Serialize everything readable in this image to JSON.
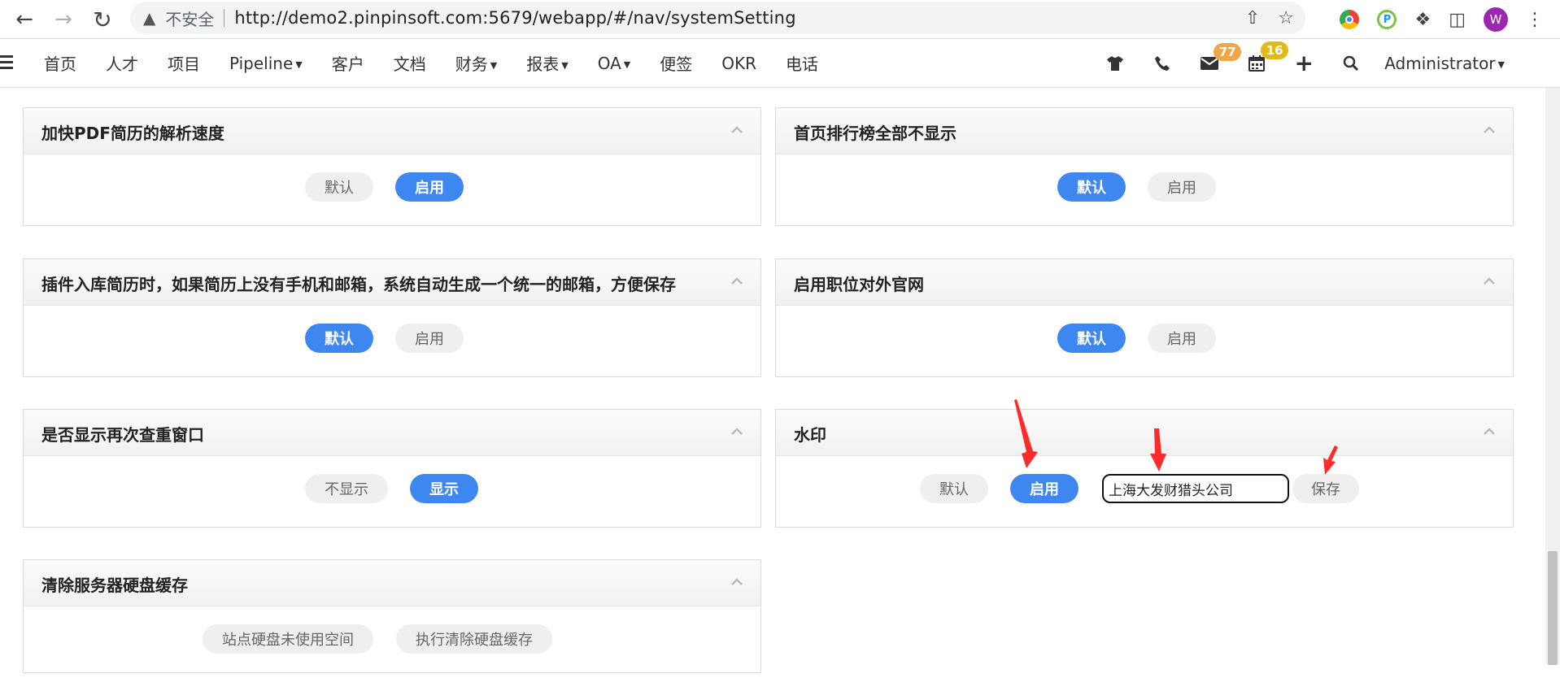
{
  "browser": {
    "security_warning": "不安全",
    "url": "http://demo2.pinpinsoft.com:5679/webapp/#/nav/systemSetting",
    "profile_initial": "W"
  },
  "nav": {
    "items": [
      {
        "label": "首页",
        "caret": false
      },
      {
        "label": "人才",
        "caret": false
      },
      {
        "label": "项目",
        "caret": false
      },
      {
        "label": "Pipeline",
        "caret": true
      },
      {
        "label": "客户",
        "caret": false
      },
      {
        "label": "文档",
        "caret": false
      },
      {
        "label": "财务",
        "caret": true
      },
      {
        "label": "报表",
        "caret": true
      },
      {
        "label": "OA",
        "caret": true
      },
      {
        "label": "便签",
        "caret": false
      },
      {
        "label": "OKR",
        "caret": false
      },
      {
        "label": "电话",
        "caret": false
      }
    ],
    "mail_badge": "77",
    "calendar_badge": "16",
    "user": "Administrator",
    "badge_colors": {
      "mail": "#f0a64a",
      "calendar": "#e3b918"
    }
  },
  "settings": {
    "pdf_speed": {
      "title": "加快PDF简历的解析速度",
      "opt_default": "默认",
      "opt_enable": "启用",
      "selected": "enable"
    },
    "hide_ranking": {
      "title": "首页排行榜全部不显示",
      "opt_default": "默认",
      "opt_enable": "启用",
      "selected": "default"
    },
    "plugin_email": {
      "title": "插件入库简历时，如果简历上没有手机和邮箱，系统自动生成一个统一的邮箱，方便保存",
      "opt_default": "默认",
      "opt_enable": "启用",
      "selected": "default"
    },
    "job_website": {
      "title": "启用职位对外官网",
      "opt_default": "默认",
      "opt_enable": "启用",
      "selected": "default"
    },
    "recheck_window": {
      "title": "是否显示再次查重窗口",
      "opt_hide": "不显示",
      "opt_show": "显示",
      "selected": "show"
    },
    "watermark": {
      "title": "水印",
      "opt_default": "默认",
      "opt_enable": "启用",
      "selected": "enable",
      "text_value": "上海大发财猎头公司",
      "save_label": "保存"
    },
    "disk_cache": {
      "title": "清除服务器硬盘缓存",
      "btn_free_space": "站点硬盘未使用空间",
      "btn_clear": "执行清除硬盘缓存"
    }
  },
  "colors": {
    "accent": "#3f87f0",
    "annotation_arrow": "#ff2a2a"
  }
}
